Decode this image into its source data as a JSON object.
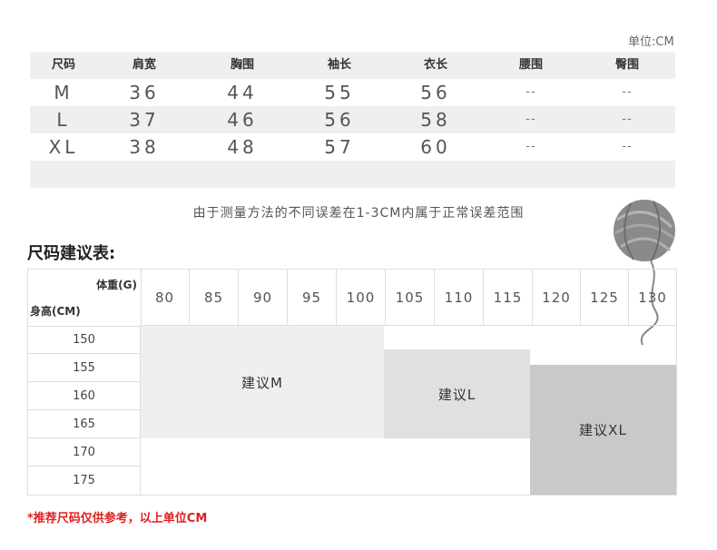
{
  "unit_label": "单位:CM",
  "measure_table": {
    "headers": [
      "尺码",
      "肩宽",
      "胸围",
      "袖长",
      "衣长",
      "腰围",
      "臀围"
    ],
    "rows": [
      [
        "M",
        "36",
        "44",
        "55",
        "56",
        "--",
        "--"
      ],
      [
        "L",
        "37",
        "46",
        "56",
        "58",
        "--",
        "--"
      ],
      [
        "XL",
        "38",
        "48",
        "57",
        "60",
        "--",
        "--"
      ]
    ]
  },
  "note": "由于测量方法的不同误差在1-3CM内属于正常误差范围",
  "suggest_title": "尺码建议表:",
  "suggest_table": {
    "weight_label": "体重(G)",
    "height_label": "身高(CM)",
    "weights": [
      "80",
      "85",
      "90",
      "95",
      "100",
      "105",
      "110",
      "115",
      "120",
      "125",
      "130"
    ],
    "heights": [
      "150",
      "155",
      "160",
      "165",
      "170",
      "175"
    ],
    "zones": [
      {
        "label": "建议M",
        "color": "#efefef"
      },
      {
        "label": "建议L",
        "color": "#e0e0e0"
      },
      {
        "label": "建议XL",
        "color": "#c9c9c9"
      }
    ]
  },
  "footnote": "*推荐尺码仅供参考，以上单位CM",
  "icons": {
    "decoration": "yarn-ball-icon"
  }
}
